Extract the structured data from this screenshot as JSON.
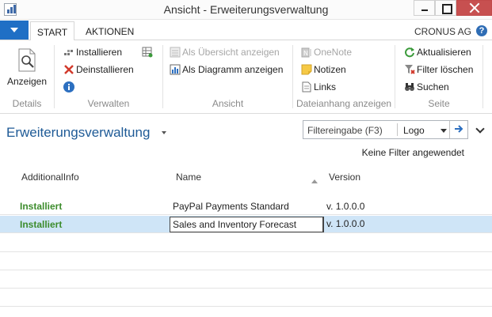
{
  "window": {
    "title": "Ansicht - Erweiterungsverwaltung"
  },
  "ribbon_tabs": [
    {
      "label": "START",
      "active": true
    },
    {
      "label": "AKTIONEN",
      "active": false
    }
  ],
  "company": "CRONUS AG",
  "ribbon": {
    "details": {
      "label": "Details",
      "view_label": "Anzeigen"
    },
    "verwalten": {
      "label": "Verwalten",
      "install": "Installieren",
      "uninstall": "Deinstallieren"
    },
    "ansicht": {
      "label": "Ansicht",
      "as_overview": "Als Übersicht anzeigen",
      "as_diagram": "Als Diagramm anzeigen"
    },
    "anhang": {
      "label": "Dateianhang anzeigen",
      "onenote": "OneNote",
      "notes": "Notizen",
      "links": "Links"
    },
    "seite": {
      "label": "Seite",
      "refresh": "Aktualisieren",
      "clear_filter": "Filter löschen",
      "search": "Suchen"
    }
  },
  "page": {
    "title": "Erweiterungsverwaltung",
    "filter_placeholder": "Filtereingabe (F3)",
    "filter_field": "Logo",
    "filter_status": "Keine Filter angewendet"
  },
  "table": {
    "columns": [
      "AdditionalInfo",
      "Name",
      "Version"
    ],
    "rows": [
      {
        "info": "Installiert",
        "name": "PayPal Payments Standard",
        "version": "v. 1.0.0.0"
      },
      {
        "info": "Installiert",
        "name": "Sales and Inventory Forecast",
        "version": "v. 1.0.0.0"
      }
    ]
  },
  "colors": {
    "accent": "#1f6fc5",
    "status_installed": "#3c8c2c",
    "selection": "#cfe5f7",
    "page_title": "#1e5a96"
  }
}
